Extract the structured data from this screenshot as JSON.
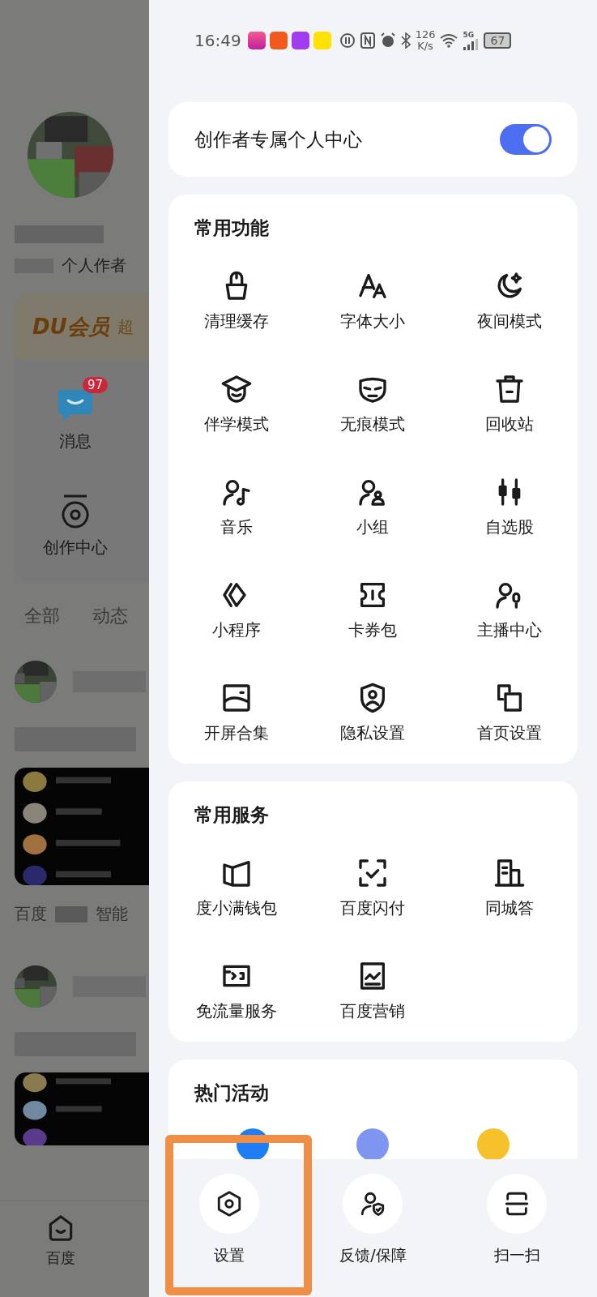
{
  "background_page": {
    "author_label": "个人作者",
    "member_title": "DU会员",
    "member_subtitle": "超",
    "shortcuts": [
      {
        "label": "消息",
        "badge": "97"
      },
      {
        "label": "创作中心"
      }
    ],
    "tabs": [
      {
        "label": "全部"
      },
      {
        "label": "动态"
      }
    ],
    "feed_source": "百度",
    "feed_tag": "智能",
    "bottom_nav": [
      {
        "label": "百度"
      }
    ]
  },
  "status_bar": {
    "time": "16:49",
    "speed_value": "126",
    "speed_unit": "K/s",
    "network": "5G",
    "battery": "67"
  },
  "creator_center": {
    "label": "创作者专属个人中心",
    "on": true
  },
  "sections": [
    {
      "title": "常用功能",
      "items": [
        {
          "label": "清理缓存"
        },
        {
          "label": "字体大小"
        },
        {
          "label": "夜间模式"
        },
        {
          "label": "伴学模式"
        },
        {
          "label": "无痕模式"
        },
        {
          "label": "回收站"
        },
        {
          "label": "音乐"
        },
        {
          "label": "小组"
        },
        {
          "label": "自选股"
        },
        {
          "label": "小程序"
        },
        {
          "label": "卡券包"
        },
        {
          "label": "主播中心"
        },
        {
          "label": "开屏合集"
        },
        {
          "label": "隐私设置"
        },
        {
          "label": "首页设置"
        }
      ]
    },
    {
      "title": "常用服务",
      "items": [
        {
          "label": "度小满钱包"
        },
        {
          "label": "百度闪付"
        },
        {
          "label": "同城答"
        },
        {
          "label": "免流量服务"
        },
        {
          "label": "百度营销"
        }
      ]
    },
    {
      "title": "热门活动"
    }
  ],
  "bottom_actions": [
    {
      "label": "设置",
      "highlighted": true
    },
    {
      "label": "反馈/保障",
      "highlighted": false
    },
    {
      "label": "扫一扫",
      "highlighted": false
    }
  ]
}
